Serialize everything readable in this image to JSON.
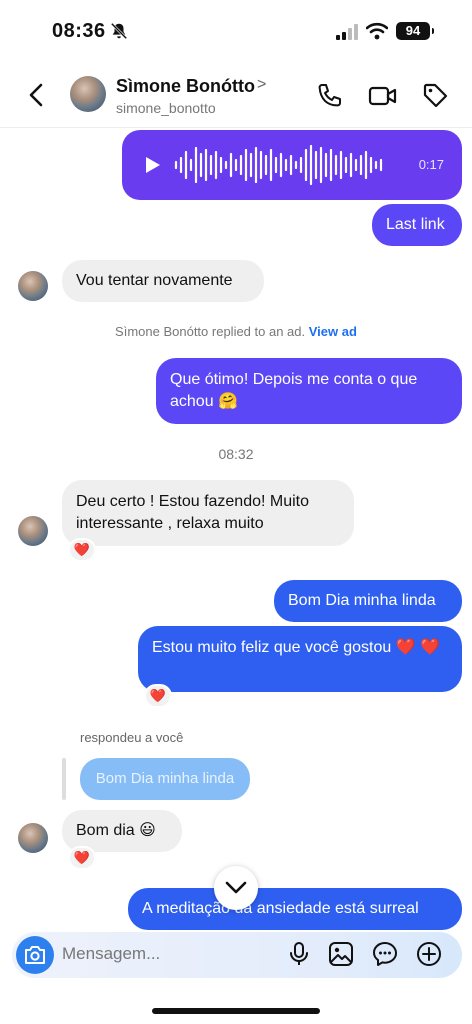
{
  "status": {
    "time": "08:36",
    "battery": "94"
  },
  "header": {
    "name": "Sìmone Bonótto",
    "chevron": ">",
    "username": "simone_bonotto"
  },
  "voice": {
    "duration": "0:17"
  },
  "messages": {
    "last_link": "Last link",
    "vou_tentar": "Vou tentar novamente",
    "que_otimo": "Que ótimo! Depois me conta o que achou 🤗",
    "deu_certo": "Deu certo ! Estou fazendo! Muito interessante , relaxa muito",
    "bom_dia_linda": "Bom Dia minha linda",
    "estou_feliz": "Estou muito feliz que você gostou ❤️ ❤️",
    "bom_dia": "Bom dia 😃",
    "meditacao": "A meditação da ansiedade está surreal"
  },
  "system": {
    "replied_text": "Sìmone Bonótto replied to an ad.",
    "view_ad": "View ad"
  },
  "timestamp": "08:32",
  "reply": {
    "meta": "respondeu a você",
    "quote": "Bom Dia minha linda"
  },
  "reaction": "❤️",
  "composer": {
    "placeholder": "Mensagem..."
  }
}
